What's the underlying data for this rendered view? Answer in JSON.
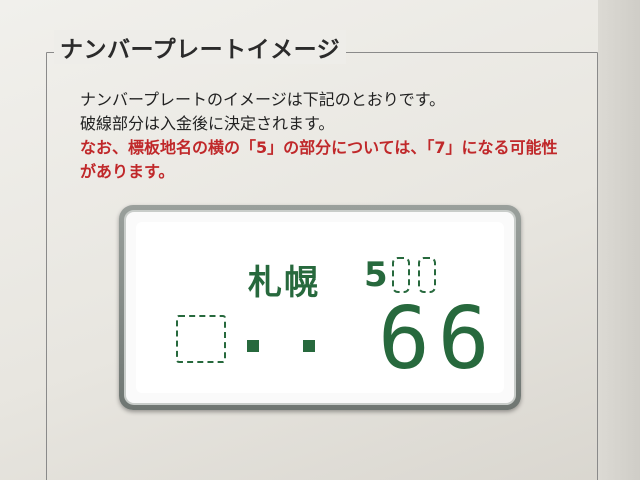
{
  "panel": {
    "title": "ナンバープレートイメージ"
  },
  "description": {
    "line1": "ナンバープレートのイメージは下記のとおりです。",
    "line2": "破線部分は入金後に決定されます。",
    "note": "なお、標板地名の横の「5」の部分については、「7」になる可能性があります。"
  },
  "plate": {
    "region": "札幌",
    "class_number": "5",
    "serial_number": "66",
    "color": "#27693d"
  }
}
